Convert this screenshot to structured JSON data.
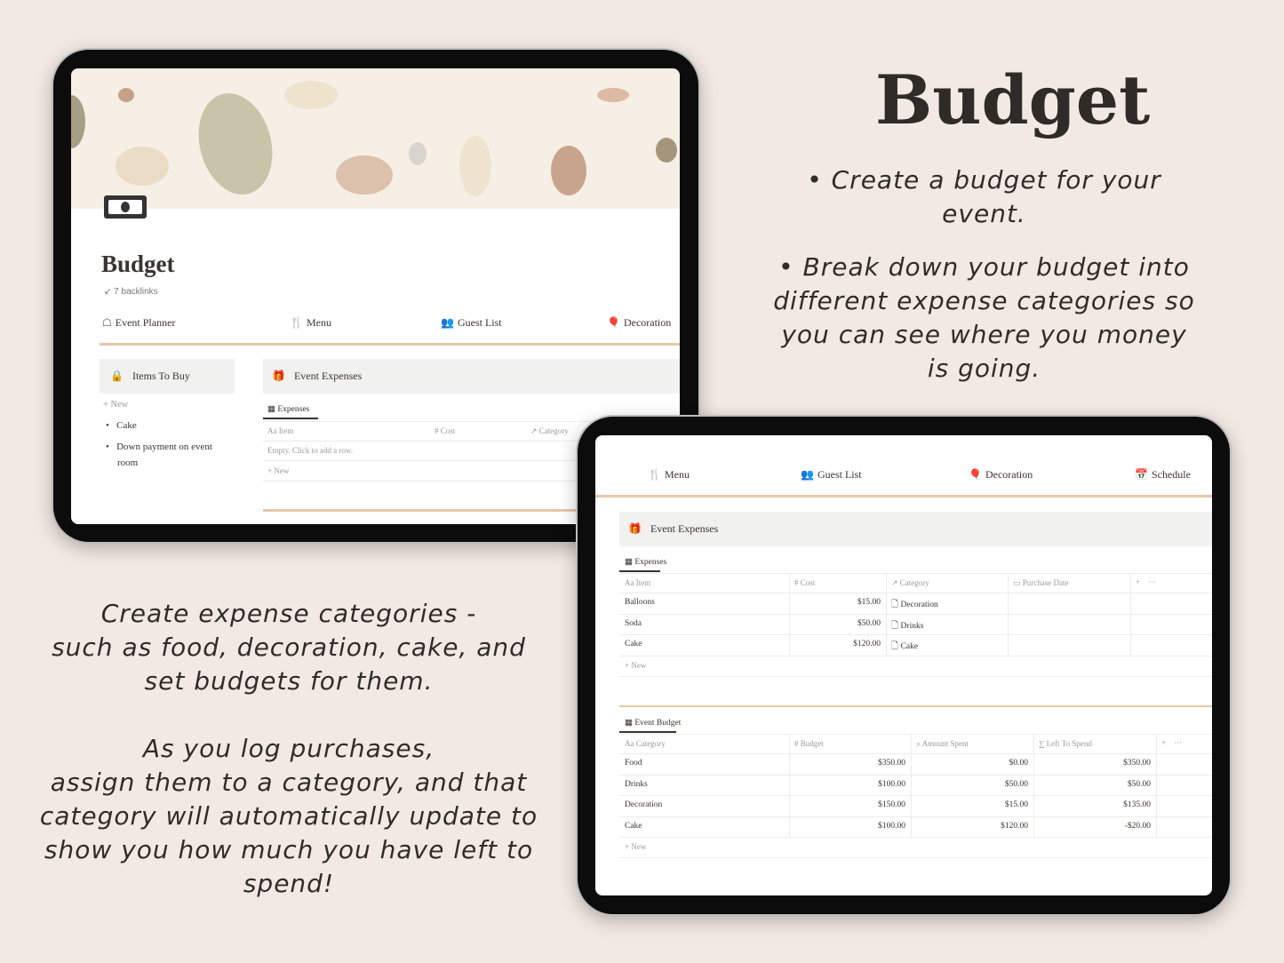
{
  "hero": {
    "title": "Budget",
    "bullets": [
      "• Create a budget for your event.",
      "• Break down your budget into",
      "different expense categories so",
      "you can see where you money",
      "is going."
    ]
  },
  "pitch": {
    "lines1": [
      "Create expense categories -",
      "such as food, decoration, cake, and",
      "set budgets for them."
    ],
    "lines2": [
      "As you log purchases,",
      "assign them to a category, and that",
      "category will automatically update to",
      "show you how much you have left to",
      "spend!"
    ]
  },
  "colors": {
    "background": "#f3e9e4",
    "accent_line": "#e6c7a9",
    "callout_bg": "#f1f1ef"
  },
  "tablet1": {
    "page_icon": "money-icon",
    "title": "Budget",
    "backlinks": "7 backlinks",
    "nav": [
      {
        "label": "Event Planner",
        "icon": "party-icon"
      },
      {
        "label": "Menu",
        "icon": "utensils-icon"
      },
      {
        "label": "Guest List",
        "icon": "people-icon"
      },
      {
        "label": "Decoration",
        "icon": "balloon-icon"
      }
    ],
    "items_callout": "Items To Buy",
    "new": "New",
    "items": [
      "Cake",
      "Down payment on event",
      "room"
    ],
    "expenses_callout": "Event Expenses",
    "tab": "Expenses",
    "columns": [
      "Item",
      "Cost",
      "Category"
    ],
    "empty": "Empty. Click to add a row.",
    "new_row": "New"
  },
  "tablet2": {
    "nav": [
      {
        "label": "Menu",
        "icon": "utensils-icon"
      },
      {
        "label": "Guest List",
        "icon": "people-icon"
      },
      {
        "label": "Decoration",
        "icon": "balloon-icon"
      },
      {
        "label": "Schedule",
        "icon": "calendar-icon"
      }
    ],
    "expenses_callout": "Event Expenses",
    "expenses": {
      "tab": "Expenses",
      "columns": [
        "Item",
        "Cost",
        "Category",
        "Purchase Date"
      ],
      "rows": [
        [
          "Balloons",
          "$15.00",
          "Decoration",
          ""
        ],
        [
          "Soda",
          "$50.00",
          "Drinks",
          ""
        ],
        [
          "Cake",
          "$120.00",
          "Cake",
          ""
        ]
      ],
      "new": "New"
    },
    "budget": {
      "tab": "Event Budget",
      "columns": [
        "Category",
        "Budget",
        "Amount Spent",
        "Left To Spend"
      ],
      "rows": [
        [
          "Food",
          "$350.00",
          "$0.00",
          "$350.00"
        ],
        [
          "Drinks",
          "$100.00",
          "$50.00",
          "$50.00"
        ],
        [
          "Decoration",
          "$150.00",
          "$15.00",
          "$135.00"
        ],
        [
          "Cake",
          "$100.00",
          "$120.00",
          "-$20.00"
        ]
      ],
      "new": "New"
    }
  }
}
